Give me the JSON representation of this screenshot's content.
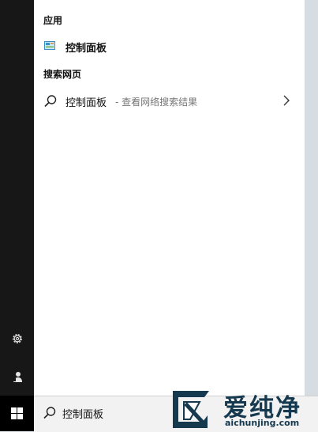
{
  "results": {
    "apps_heading": "应用",
    "app_name": "控制面板",
    "web_heading": "搜索网页",
    "web_query": "控制面板",
    "web_hint": " - 查看网络搜索结果"
  },
  "search": {
    "value": "控制面板"
  },
  "watermark": {
    "title": "爱纯净",
    "url": "aichunjing.com"
  },
  "icons": {
    "settings": "gear-icon",
    "user": "user-icon",
    "start": "windows-logo-icon",
    "search": "search-icon",
    "chevron": "chevron-right-icon",
    "app": "control-panel-icon"
  },
  "colors": {
    "rail": "#171717",
    "panel": "#ffffff",
    "hint_text": "#767676",
    "watermark": "#15394f"
  }
}
